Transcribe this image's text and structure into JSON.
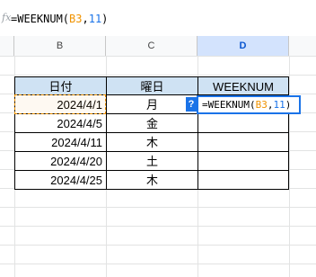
{
  "formula_bar": {
    "fx_glyph": "fx",
    "prefix": "=WEEKNUM(",
    "ref": "B3",
    "sep": ",",
    "num": "11",
    "suffix": ")"
  },
  "columns": [
    {
      "label": "B",
      "selected": false
    },
    {
      "label": "C",
      "selected": false
    },
    {
      "label": "D",
      "selected": true
    }
  ],
  "table": {
    "headers": [
      "日付",
      "曜日",
      "WEEKNUM"
    ],
    "rows": [
      {
        "date": "2024/4/1",
        "day": "月"
      },
      {
        "date": "2024/4/5",
        "day": "金"
      },
      {
        "date": "2024/4/11",
        "day": "木"
      },
      {
        "date": "2024/4/20",
        "day": "土"
      },
      {
        "date": "2024/4/25",
        "day": "木"
      }
    ]
  },
  "editor": {
    "help_icon": "?",
    "prefix": "=WEEKNUM(",
    "ref": "B3",
    "sep": ",",
    "num": "11",
    "suffix": ")"
  },
  "colors": {
    "reference": "#f09300",
    "accent": "#1a73e8",
    "header_fill": "#cfe2f3"
  }
}
